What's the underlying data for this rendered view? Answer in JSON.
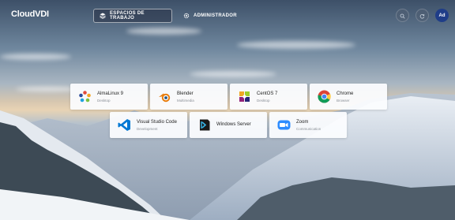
{
  "header": {
    "logo": "CloudVDI",
    "tabs": [
      {
        "label": "ESPACIOS DE TRABAJO",
        "active": true,
        "icon": "workspaces-icon"
      },
      {
        "label": "ADMINISTRADOR",
        "active": false,
        "icon": "settings-icon"
      }
    ],
    "tools": [
      {
        "icon": "search-icon"
      },
      {
        "icon": "refresh-icon"
      }
    ],
    "avatar_initials": "Ad"
  },
  "apps": {
    "row1": [
      {
        "name": "AlmaLinux 9",
        "category": "Desktop",
        "icon": "almalinux-icon"
      },
      {
        "name": "Blender",
        "category": "Multimedia",
        "icon": "blender-icon"
      },
      {
        "name": "CentOS 7",
        "category": "Desktop",
        "icon": "centos-icon"
      },
      {
        "name": "Chrome",
        "category": "Browser",
        "icon": "chrome-icon"
      }
    ],
    "row2": [
      {
        "name": "Visual Studio Code",
        "category": "Development",
        "icon": "vscode-icon"
      },
      {
        "name": "Windows Server",
        "category": "",
        "icon": "windows-server-icon"
      },
      {
        "name": "Zoom",
        "category": "Communication",
        "icon": "zoom-icon"
      }
    ]
  },
  "colors": {
    "accent": "#1f3d88",
    "card_bg": "#fcfdff"
  }
}
